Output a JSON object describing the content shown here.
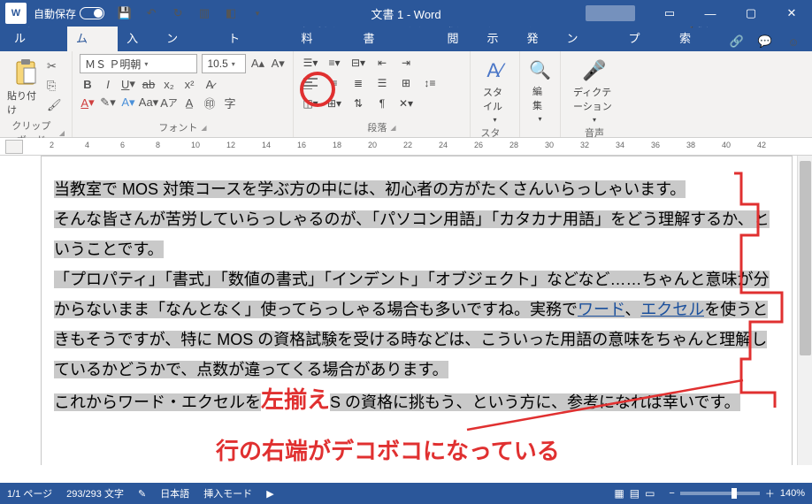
{
  "titlebar": {
    "autosave_label": "自動保存",
    "autosave_state": "オフ",
    "doc_title": "文書 1  -  Word"
  },
  "tabs": {
    "file": "ファイル",
    "home": "ホーム",
    "insert": "挿入",
    "design": "デザイン",
    "layout": "レイアウト",
    "references": "参考資料",
    "mailings": "差し込み文書",
    "review": "校閲",
    "view": "表示",
    "developer": "開発",
    "addins": "アドイン",
    "help": "ヘルプ",
    "search": "検索"
  },
  "ribbon": {
    "clipboard": {
      "paste": "貼り付け",
      "label": "クリップボード"
    },
    "font": {
      "name": "ＭＳ Ｐ明朝",
      "size": "10.5",
      "label": "フォント"
    },
    "paragraph": {
      "label": "段落"
    },
    "styles": {
      "btn": "スタイル",
      "label": "スタイル"
    },
    "editing": {
      "btn": "編集"
    },
    "voice": {
      "btn": "ディクテーション",
      "label": "音声"
    }
  },
  "ruler": {
    "marks": [
      "2",
      "4",
      "6",
      "8",
      "10",
      "12",
      "14",
      "16",
      "18",
      "20",
      "22",
      "24",
      "26",
      "28",
      "30",
      "32",
      "34",
      "36",
      "38",
      "40",
      "42"
    ]
  },
  "document": {
    "p1": "当教室で MOS 対策コースを学ぶ方の中には、初心者の方がたくさんいらっしゃいます。",
    "p2": "そんな皆さんが苦労していらっしゃるのが、「パソコン用語」「カタカナ用語」をどう理解するか、ということです。",
    "p3a": "「プロパティ」「書式」「数値の書式」「インデント」「オブジェクト」などなど……ちゃんと意味が分からないまま「なんとなく」使ってらっしゃる場合も多いですね。実務で",
    "p3link1": "ワード",
    "p3mid": "、",
    "p3link2": "エクセル",
    "p3b": "を使うときもそうですが、特に MOS の資格試験を受ける時などは、こういった用語の意味をちゃんと理解しているかどうかで、点数が違ってくる場合があります。",
    "p4a": "これからワード・エクセルを",
    "p4cover": "左揃え",
    "p4b": "S の資格に挑もう、という方に、参考になれば幸いです。"
  },
  "annotations": {
    "left_align": "左揃え",
    "ragged_right": "行の右端がデコボコになっている"
  },
  "status": {
    "page": "1/1 ページ",
    "words": "293/293 文字",
    "lang": "日本語",
    "insert": "挿入モード",
    "zoom": "140%"
  }
}
